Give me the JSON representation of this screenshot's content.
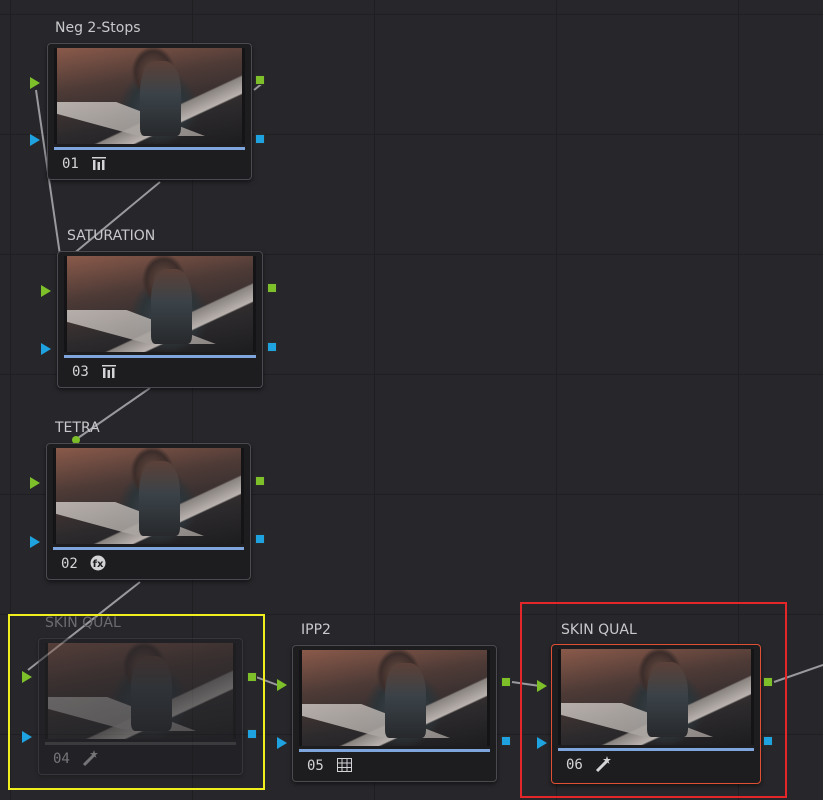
{
  "node_graph": {
    "nodes": [
      {
        "id": "01",
        "label": "Neg 2-Stops",
        "number": "01",
        "tool_icon": "bars-icon",
        "state": "normal"
      },
      {
        "id": "03",
        "label": "SATURATION",
        "number": "03",
        "tool_icon": "bars-icon",
        "state": "normal"
      },
      {
        "id": "02",
        "label": "TETRA",
        "number": "02",
        "tool_icon": "resolve-fx-icon",
        "state": "normal"
      },
      {
        "id": "04",
        "label": "SKIN QUAL",
        "number": "04",
        "tool_icon": "magic-wand-icon",
        "state": "disabled"
      },
      {
        "id": "05",
        "label": "IPP2",
        "number": "05",
        "tool_icon": "grid-icon",
        "state": "normal"
      },
      {
        "id": "06",
        "label": "SKIN QUAL",
        "number": "06",
        "tool_icon": "magic-wand-icon",
        "state": "selected"
      }
    ],
    "annotations": [
      {
        "name": "yellow-highlight",
        "color": "#f0ee1e",
        "around_node": "04"
      },
      {
        "name": "red-highlight",
        "color": "#e2262a",
        "around_node": "06"
      }
    ],
    "colors": {
      "rgb_input": "#7dc02a",
      "alpha_input": "#1fa3e0",
      "progress": "#7ea6dc",
      "selected_border": "#e05035"
    }
  }
}
